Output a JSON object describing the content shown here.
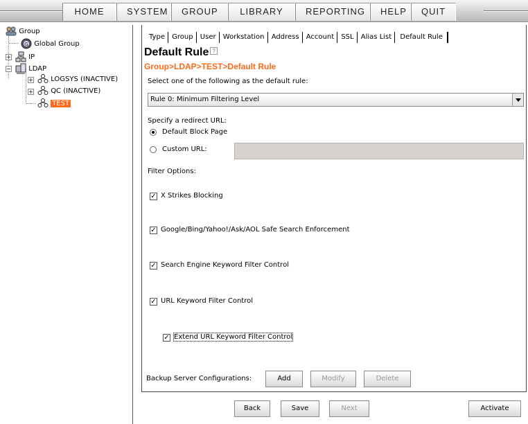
{
  "menu": [
    "HOME",
    "SYSTEM",
    "GROUP",
    "LIBRARY",
    "REPORTING",
    "HELP",
    "QUIT"
  ],
  "tree": {
    "root": "Group",
    "global": "Global Group",
    "ip": "IP",
    "ldap": "LDAP",
    "logsys": "LOGSYS (INACTIVE)",
    "qc": "QC (INACTIVE)",
    "test": "TEST"
  },
  "tabs": [
    "Type",
    "Group",
    "User",
    "Workstation",
    "Address",
    "Account",
    "SSL",
    "Alias List",
    "Default Rule"
  ],
  "page": {
    "title": "Default Rule",
    "breadcrumb": "Group>LDAP>TEST>Default Rule",
    "select_prompt": "Select one of the following as the default rule:",
    "selected_rule": "Rule 0: Minimum Filtering Level",
    "redirect_prompt": "Specify a redirect URL:",
    "default_block": "Default Block Page",
    "custom_url": "Custom URL:",
    "custom_url_value": "",
    "filter_options": "Filter Options:",
    "options": [
      "X Strikes Blocking",
      "Google/Bing/Yahoo!/Ask/AOL Safe Search Enforcement",
      "Search Engine Keyword Filter Control",
      "URL Keyword Filter Control",
      "Extend URL Keyword Filter Control"
    ],
    "backup_label": "Backup Server Configurations:"
  },
  "buttons": {
    "add": "Add",
    "modify": "Modify",
    "delete": "Delete",
    "back": "Back",
    "save": "Save",
    "next": "Next",
    "activate": "Activate"
  },
  "icons": {
    "group": "group-icon",
    "global": "globe-icon",
    "ip": "network-icon",
    "ldap": "ldap-icon",
    "user_group": "users-icon"
  },
  "colors": {
    "accent": "#ff6a1a"
  }
}
